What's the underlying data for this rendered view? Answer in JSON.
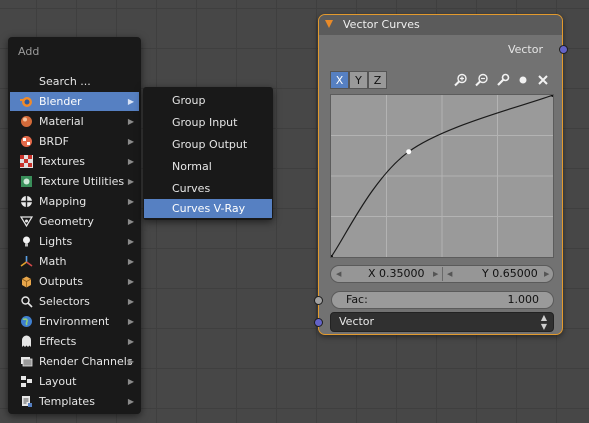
{
  "add_menu": {
    "title": "Add",
    "items": [
      {
        "label": "Search ...",
        "icon": "search",
        "has_submenu": false,
        "active": false
      },
      {
        "label": "Blender",
        "icon": "blender-icon",
        "has_submenu": true,
        "active": true
      },
      {
        "label": "Material",
        "icon": "material-sphere-icon",
        "has_submenu": true,
        "active": false
      },
      {
        "label": "BRDF",
        "icon": "brdf-icon",
        "has_submenu": true,
        "active": false
      },
      {
        "label": "Textures",
        "icon": "checker-texture-icon",
        "has_submenu": true,
        "active": false
      },
      {
        "label": "Texture Utilities",
        "icon": "texture-utility-icon",
        "has_submenu": true,
        "active": false
      },
      {
        "label": "Mapping",
        "icon": "mapping-icon",
        "has_submenu": true,
        "active": false
      },
      {
        "label": "Geometry",
        "icon": "geometry-icon",
        "has_submenu": true,
        "active": false
      },
      {
        "label": "Lights",
        "icon": "light-bulb-icon",
        "has_submenu": true,
        "active": false
      },
      {
        "label": "Math",
        "icon": "math-axes-icon",
        "has_submenu": true,
        "active": false
      },
      {
        "label": "Outputs",
        "icon": "output-box-icon",
        "has_submenu": true,
        "active": false
      },
      {
        "label": "Selectors",
        "icon": "selector-icon",
        "has_submenu": true,
        "active": false
      },
      {
        "label": "Environment",
        "icon": "globe-icon",
        "has_submenu": true,
        "active": false
      },
      {
        "label": "Effects",
        "icon": "effects-ghost-icon",
        "has_submenu": true,
        "active": false
      },
      {
        "label": "Render Channels",
        "icon": "render-channels-icon",
        "has_submenu": true,
        "active": false
      },
      {
        "label": "Layout",
        "icon": "layout-icon",
        "has_submenu": true,
        "active": false
      },
      {
        "label": "Templates",
        "icon": "templates-icon",
        "has_submenu": true,
        "active": false
      }
    ]
  },
  "submenu": {
    "items": [
      {
        "label": "Group",
        "active": false
      },
      {
        "label": "Group Input",
        "active": false
      },
      {
        "label": "Group Output",
        "active": false
      },
      {
        "label": "Normal",
        "active": false
      },
      {
        "label": "Curves",
        "active": false
      },
      {
        "label": "Curves V-Ray",
        "active": true
      }
    ]
  },
  "node": {
    "title": "Vector Curves",
    "output_label": "Vector",
    "axis_buttons": [
      {
        "label": "X",
        "active": true
      },
      {
        "label": "Y",
        "active": false
      },
      {
        "label": "Z",
        "active": false
      }
    ],
    "tools": [
      "zoom-in-icon",
      "zoom-out-icon",
      "wrench-icon",
      "dot-icon",
      "close-icon"
    ],
    "curve": {
      "points": [
        [
          0.0,
          0.0
        ],
        [
          0.35,
          0.65
        ],
        [
          1.0,
          1.0
        ]
      ],
      "selected_index": 1
    },
    "coord_x_label": "X 0.35000",
    "coord_y_label": "Y 0.65000",
    "fac_label": "Fac:",
    "fac_value": "1.000",
    "vector_select": "Vector"
  },
  "colors": {
    "accent": "#5680c2",
    "node_border": "#e39a2d",
    "socket_vector": "#6363c7",
    "socket_fac": "#a1a1a1"
  }
}
